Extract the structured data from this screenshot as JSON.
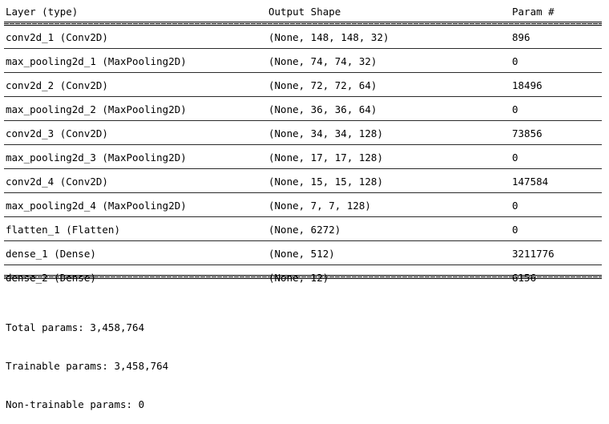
{
  "summary": {
    "headers": {
      "layer": "Layer (type)",
      "output_shape": "Output Shape",
      "params": "Param #"
    },
    "layers": [
      {
        "layer": "conv2d_1 (Conv2D)",
        "output_shape": "(None, 148, 148, 32)",
        "params": "896"
      },
      {
        "layer": "max_pooling2d_1 (MaxPooling2D)",
        "output_shape": "(None, 74, 74, 32)",
        "params": "0"
      },
      {
        "layer": "conv2d_2 (Conv2D)",
        "output_shape": "(None, 72, 72, 64)",
        "params": "18496"
      },
      {
        "layer": "max_pooling2d_2 (MaxPooling2D)",
        "output_shape": "(None, 36, 36, 64)",
        "params": "0"
      },
      {
        "layer": "conv2d_3 (Conv2D)",
        "output_shape": "(None, 34, 34, 128)",
        "params": "73856"
      },
      {
        "layer": "max_pooling2d_3 (MaxPooling2D)",
        "output_shape": "(None, 17, 17, 128)",
        "params": "0"
      },
      {
        "layer": "conv2d_4 (Conv2D)",
        "output_shape": "(None, 15, 15, 128)",
        "params": "147584"
      },
      {
        "layer": "max_pooling2d_4 (MaxPooling2D)",
        "output_shape": "(None, 7, 7, 128)",
        "params": "0"
      },
      {
        "layer": "flatten_1 (Flatten)",
        "output_shape": "(None, 6272)",
        "params": "0"
      },
      {
        "layer": "dense_1 (Dense)",
        "output_shape": "(None, 512)",
        "params": "3211776"
      },
      {
        "layer": "dense_2 (Dense)",
        "output_shape": "(None, 12)",
        "params": "6156"
      }
    ],
    "totals": {
      "total": "Total params: 3,458,764",
      "trainable": "Trainable params: 3,458,764",
      "non_trainable": "Non-trainable params: 0"
    }
  }
}
